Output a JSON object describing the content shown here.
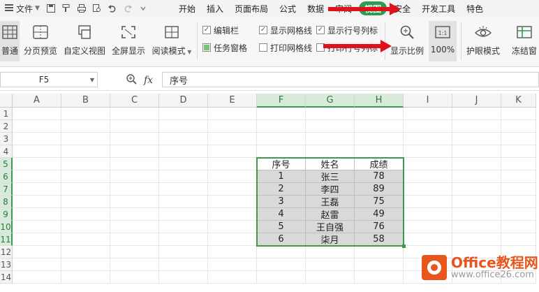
{
  "menu": {
    "file_label": "文件",
    "tabs": [
      "开始",
      "插入",
      "页面布局",
      "公式",
      "数据",
      "审阅",
      "视图",
      "安全",
      "开发工具",
      "特色"
    ],
    "active_tab": "视图"
  },
  "ribbon": {
    "normal": "普通",
    "page_break_preview": "分页预览",
    "custom_view": "自定义视图",
    "full_screen": "全屏显示",
    "reading_mode": "阅读模式",
    "checks": {
      "edit_bar": "编辑栏",
      "task_pane": "任务窗格",
      "show_gridlines": "显示网格线",
      "print_gridlines": "打印网格线",
      "show_headers": "显示行号列标",
      "print_headers": "打印行号列标"
    },
    "zoom": "显示比例",
    "zoom_100": "100%",
    "eye_mode": "护眼模式",
    "freeze": "冻结窗"
  },
  "formula_bar": {
    "cell_ref": "F5",
    "fx": "fx",
    "content": "序号"
  },
  "sheet": {
    "columns": [
      "A",
      "B",
      "C",
      "D",
      "E",
      "F",
      "G",
      "H",
      "I",
      "J",
      "K"
    ],
    "selected_columns": [
      "F",
      "G",
      "H"
    ],
    "rows": [
      "1",
      "2",
      "3",
      "4",
      "5",
      "6",
      "7",
      "8",
      "9",
      "10",
      "11",
      "12",
      "13",
      "14"
    ],
    "selected_rows": [
      "5",
      "6",
      "7",
      "8",
      "9",
      "10",
      "11"
    ],
    "table_header": [
      "序号",
      "姓名",
      "成绩"
    ],
    "table_rows": [
      [
        "1",
        "张三",
        "78"
      ],
      [
        "2",
        "李四",
        "89"
      ],
      [
        "3",
        "王磊",
        "75"
      ],
      [
        "4",
        "赵雷",
        "49"
      ],
      [
        "5",
        "王自强",
        "76"
      ],
      [
        "6",
        "柒月",
        "58"
      ]
    ]
  },
  "watermark": {
    "title": "Office教程网",
    "url": "www.office26.com"
  },
  "colors": {
    "accent_green": "#2f9a52",
    "selection_green": "#3c9a4e",
    "arrow_red": "#e0111a",
    "brand_orange": "#e8561e",
    "cell_shade": "#d9d9d9"
  }
}
